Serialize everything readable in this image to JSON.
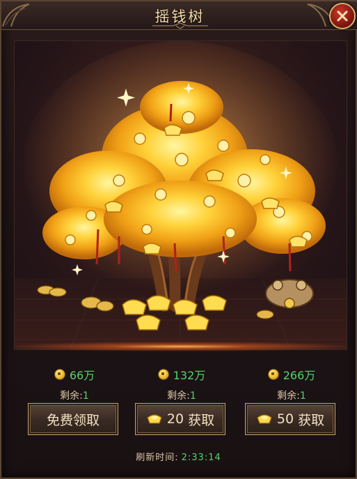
{
  "window": {
    "title": "摇钱树"
  },
  "rewards": [
    {
      "amount": "66万",
      "remain_label": "剩余:",
      "remain_count": "1",
      "button_label": "免费领取",
      "cost": ""
    },
    {
      "amount": "132万",
      "remain_label": "剩余:",
      "remain_count": "1",
      "button_label": "获取",
      "cost": "20"
    },
    {
      "amount": "266万",
      "remain_label": "剩余:",
      "remain_count": "1",
      "button_label": "获取",
      "cost": "50"
    }
  ],
  "refresh": {
    "label": "刷新时间:",
    "time": "2:33:14"
  },
  "icons": {
    "close": "close-icon",
    "coin": "coin-icon",
    "ingot": "gold-ingot-icon"
  },
  "colors": {
    "green": "#57d36a",
    "gold": "#f0c030",
    "text": "#d9c6a6"
  }
}
